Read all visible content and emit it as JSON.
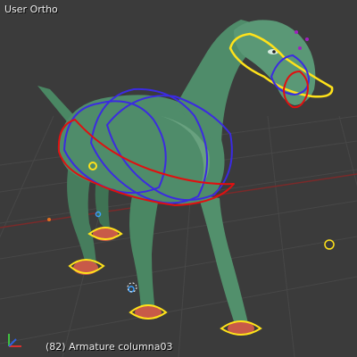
{
  "viewport": {
    "view_label": "User Ortho",
    "status_text": "(82) Armature columna03"
  },
  "colors": {
    "background": "#3b3b3b",
    "grid": "#4a4a4a",
    "model_body": "#4f8c6a",
    "model_highlight": "#7fb896",
    "model_shadow": "#2e5a43",
    "control_yellow": "#ffe21a",
    "control_red": "#e01010",
    "control_blue": "#3b2be0",
    "control_purple": "#a020c0",
    "axis_red": "#d83030",
    "axis_green": "#40c040",
    "hoof_pink": "#c85a48"
  },
  "icons": {
    "axis_gizmo": "xyz-axis-gizmo-icon"
  }
}
